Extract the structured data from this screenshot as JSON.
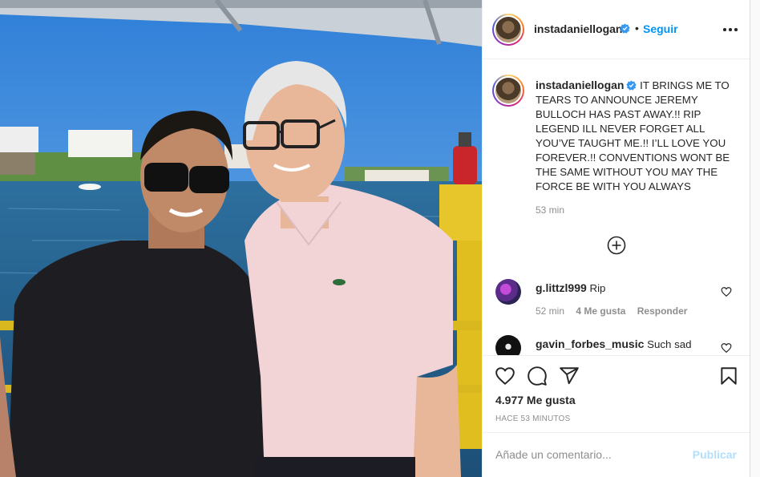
{
  "post": {
    "username": "instadaniellogan",
    "separator": "•",
    "follow_label": "Seguir",
    "caption": "IT BRINGS ME TO TEARS TO ANNOUNCE JEREMY BULLOCH HAS PAST AWAY.!! RIP LEGEND ILL NEVER FORGET ALL YOU’VE TAUGHT ME.!! I’LL LOVE YOU FOREVER.!! CONVENTIONS WONT BE THE SAME WITHOUT YOU MAY THE FORCE BE WITH YOU ALWAYS",
    "caption_time": "53 min",
    "likes": "4.977 Me gusta",
    "time_ago": "HACE 53 MINUTOS"
  },
  "comments": [
    {
      "username": "g.littzl999",
      "text": "Rip",
      "time": "52 min",
      "likes": "4 Me gusta",
      "reply": "Responder"
    },
    {
      "username": "gavin_forbes_music",
      "text": "Such sad"
    }
  ],
  "add_comment": {
    "placeholder": "Añade un comentario...",
    "post_label": "Publicar"
  },
  "icons": {
    "verified": "verified-badge-icon",
    "more": "more-options-icon",
    "load_more": "plus-circle-icon",
    "like": "heart-icon",
    "comment": "comment-icon",
    "share": "share-icon",
    "save": "bookmark-icon"
  },
  "colors": {
    "accent": "#0095f6",
    "verified": "#3897f0",
    "muted": "#8e8e8e",
    "publish_disabled": "#b2dffc"
  }
}
